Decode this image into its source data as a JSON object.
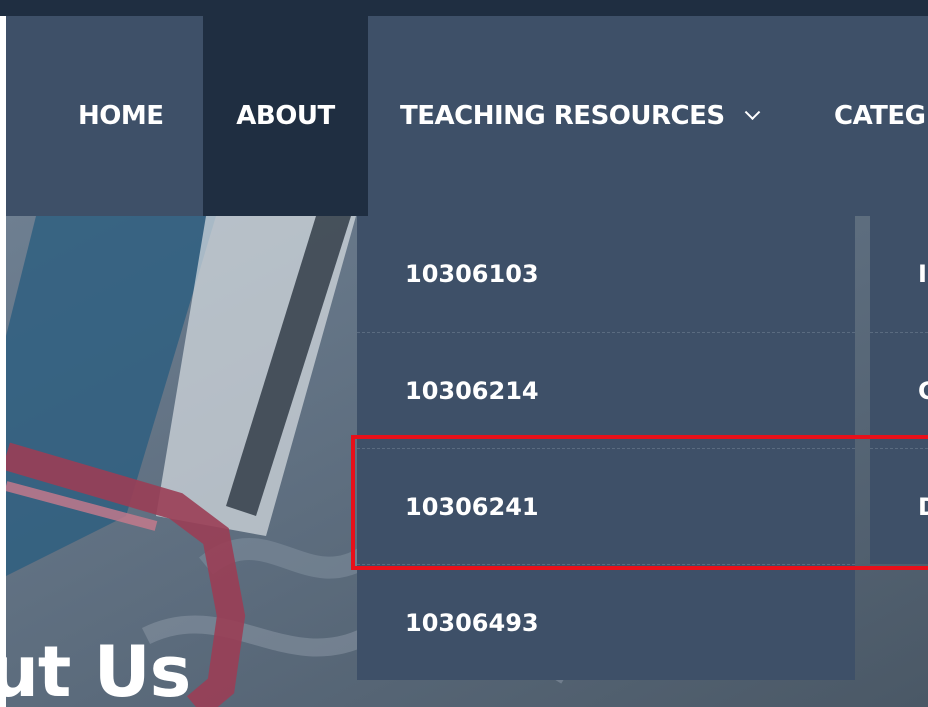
{
  "nav": {
    "home": "HOME",
    "about": "ABOUT",
    "teaching": "TEACHING RESOURCES",
    "categ": "CATEG"
  },
  "dropdown": {
    "items": [
      "10306103",
      "10306214",
      "10306241",
      "10306493"
    ]
  },
  "subcolumn": {
    "items": [
      "I",
      "C",
      "D"
    ]
  },
  "hero": {
    "title_fragment": "out Us"
  },
  "colors": {
    "nav_bg": "#3e5068",
    "active_bg": "#1f2e41",
    "highlight": "#e8101a"
  },
  "icons": {
    "teaching_dropdown": "chevron-down-icon"
  }
}
